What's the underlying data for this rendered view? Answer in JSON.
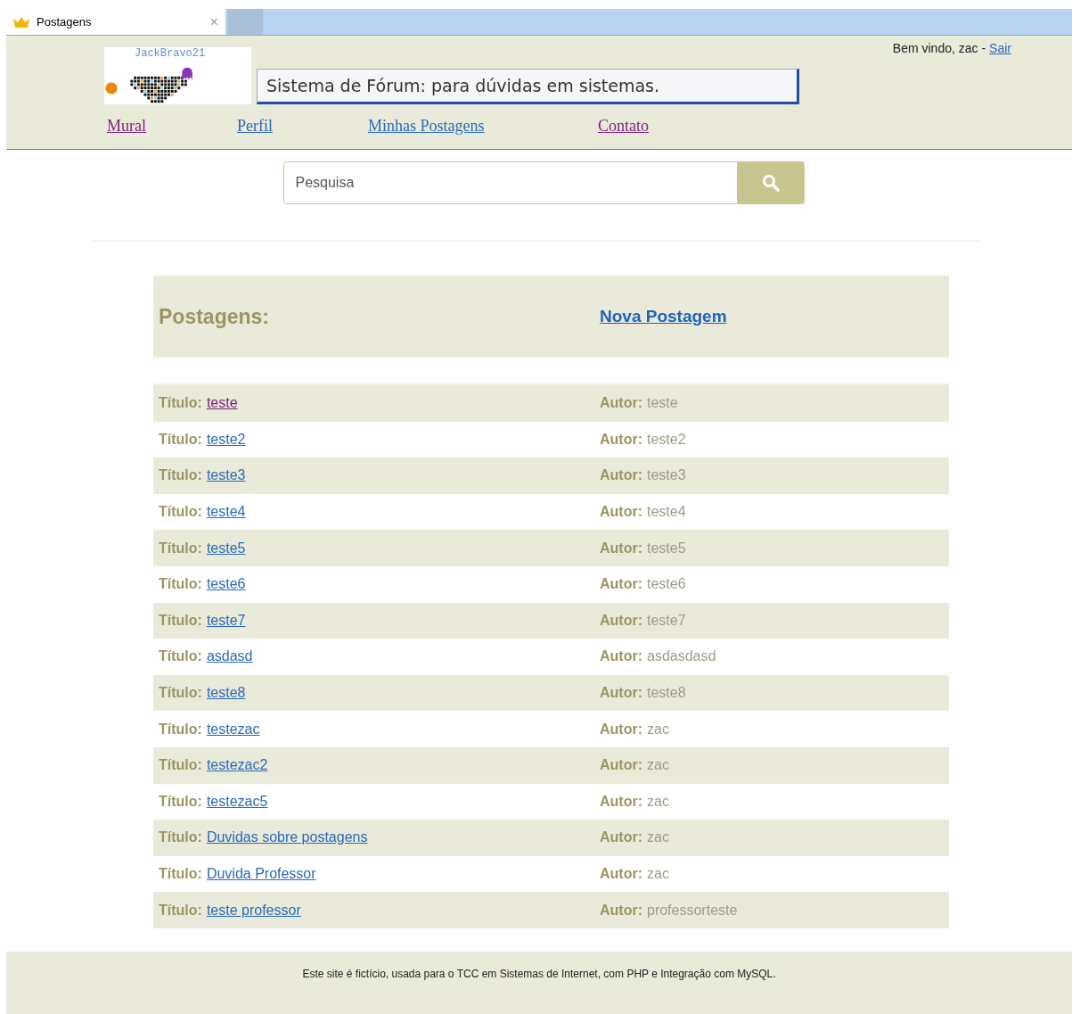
{
  "browser_tab": {
    "title": "Postagens",
    "close": "×"
  },
  "header": {
    "logo_text": "JackBravo21",
    "banner": "Sistema de Fórum: para dúvidas em sistemas.",
    "welcome": "Bem vindo, zac -",
    "logout": {
      "label": "Sair",
      "visited": false
    }
  },
  "nav": [
    {
      "label": "Mural",
      "visited": true
    },
    {
      "label": "Perfil",
      "visited": false
    },
    {
      "label": "Minhas Postagens",
      "visited": false
    },
    {
      "label": "Contato",
      "visited": true
    }
  ],
  "search": {
    "placeholder": "Pesquisa"
  },
  "posts_header": {
    "title": "Postagens:",
    "new_post": "Nova Postagem"
  },
  "posts": [
    {
      "title_label": "Título:",
      "title": "teste",
      "visited": true,
      "author_label": "Autor:",
      "author": "teste"
    },
    {
      "title_label": "Título:",
      "title": "teste2",
      "visited": false,
      "author_label": "Autor:",
      "author": "teste2"
    },
    {
      "title_label": "Título:",
      "title": "teste3",
      "visited": false,
      "author_label": "Autor:",
      "author": "teste3"
    },
    {
      "title_label": "Título:",
      "title": "teste4",
      "visited": false,
      "author_label": "Autor:",
      "author": "teste4"
    },
    {
      "title_label": "Título:",
      "title": "teste5",
      "visited": false,
      "author_label": "Autor:",
      "author": "teste5"
    },
    {
      "title_label": "Título:",
      "title": "teste6",
      "visited": false,
      "author_label": "Autor:",
      "author": "teste6"
    },
    {
      "title_label": "Título:",
      "title": "teste7",
      "visited": false,
      "author_label": "Autor:",
      "author": "teste7"
    },
    {
      "title_label": "Título:",
      "title": "asdasd",
      "visited": false,
      "author_label": "Autor:",
      "author": "asdasdasd"
    },
    {
      "title_label": "Título:",
      "title": "teste8",
      "visited": false,
      "author_label": "Autor:",
      "author": "teste8"
    },
    {
      "title_label": "Título:",
      "title": "testezac",
      "visited": false,
      "author_label": "Autor:",
      "author": "zac"
    },
    {
      "title_label": "Título:",
      "title": "testezac2",
      "visited": false,
      "author_label": "Autor:",
      "author": "zac"
    },
    {
      "title_label": "Título:",
      "title": "testezac5",
      "visited": false,
      "author_label": "Autor:",
      "author": "zac"
    },
    {
      "title_label": "Título:",
      "title": "Duvidas sobre postagens",
      "visited": false,
      "author_label": "Autor:",
      "author": "zac"
    },
    {
      "title_label": "Título:",
      "title": "Duvida Professor",
      "visited": false,
      "author_label": "Autor:",
      "author": "zac"
    },
    {
      "title_label": "Título:",
      "title": "teste professor",
      "visited": false,
      "author_label": "Autor:",
      "author": "professorteste"
    }
  ],
  "footer": "Este site é fictício, usada para o TCC em Sistemas de Internet, com PHP e Integração com MySQL."
}
